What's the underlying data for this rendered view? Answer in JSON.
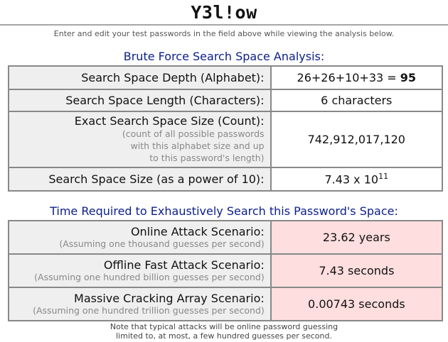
{
  "password": {
    "value": "Y3l!ow"
  },
  "hint": "Enter and edit your test passwords in the field above while viewing the analysis below.",
  "search_space": {
    "title": "Brute Force Search Space Analysis:",
    "rows": [
      {
        "label": "Search Space Depth (Alphabet):",
        "value_prefix": "26+26+10+33 = ",
        "value_bold": "95"
      },
      {
        "label": "Search Space Length (Characters):",
        "value": "6 characters"
      },
      {
        "label": "Exact Search Space Size (Count):",
        "sub1": "(count of all possible passwords",
        "sub2": "with this alphabet size and up",
        "sub3": "to this password's length)",
        "value": "742,912,017,120"
      },
      {
        "label": "Search Space Size (as a power of 10):",
        "value_base": "7.43 x 10",
        "value_exp": "11"
      }
    ]
  },
  "time_required": {
    "title": "Time Required to Exhaustively Search this Password's Space:",
    "rows": [
      {
        "label": "Online Attack Scenario:",
        "sub": "(Assuming one thousand guesses per second)",
        "value": "23.62 years"
      },
      {
        "label": "Offline Fast Attack Scenario:",
        "sub": "(Assuming one hundred billion guesses per second)",
        "value": "7.43 seconds"
      },
      {
        "label": "Massive Cracking Array Scenario:",
        "sub": "(Assuming one hundred trillion guesses per second)",
        "value": "0.00743 seconds"
      }
    ]
  },
  "footnote": {
    "line1": "Note that typical attacks will be online password guessing",
    "line2": "limited to, at most, a few hundred guesses per second."
  }
}
